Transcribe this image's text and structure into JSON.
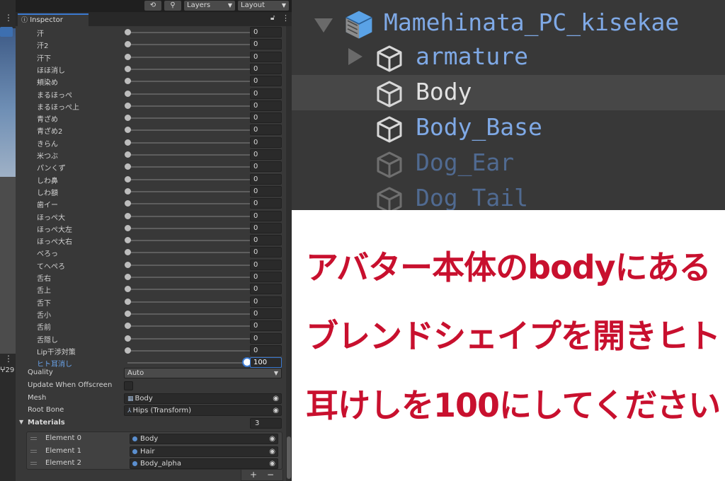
{
  "toolbar": {
    "history_icon": "history-icon",
    "search_icon": "search-icon",
    "layers_label": "Layers",
    "layout_label": "Layout"
  },
  "inspector": {
    "tab_label": "Inspector",
    "blendshapes": [
      {
        "name": "汗",
        "value": "0",
        "weight": 0
      },
      {
        "name": "汗2",
        "value": "0",
        "weight": 0
      },
      {
        "name": "汗下",
        "value": "0",
        "weight": 0
      },
      {
        "name": "ほほ消し",
        "value": "0",
        "weight": 0
      },
      {
        "name": "頬染め",
        "value": "0",
        "weight": 0
      },
      {
        "name": "まるほっぺ",
        "value": "0",
        "weight": 0
      },
      {
        "name": "まるほっぺ上",
        "value": "0",
        "weight": 0
      },
      {
        "name": "青ざめ",
        "value": "0",
        "weight": 0
      },
      {
        "name": "青ざめ2",
        "value": "0",
        "weight": 0
      },
      {
        "name": "きらん",
        "value": "0",
        "weight": 0
      },
      {
        "name": "米つぶ",
        "value": "0",
        "weight": 0
      },
      {
        "name": "パンくず",
        "value": "0",
        "weight": 0
      },
      {
        "name": "しわ鼻",
        "value": "0",
        "weight": 0
      },
      {
        "name": "しわ額",
        "value": "0",
        "weight": 0
      },
      {
        "name": "歯イー",
        "value": "0",
        "weight": 0
      },
      {
        "name": "ほっぺ大",
        "value": "0",
        "weight": 0
      },
      {
        "name": "ほっぺ大左",
        "value": "0",
        "weight": 0
      },
      {
        "name": "ほっぺ大右",
        "value": "0",
        "weight": 0
      },
      {
        "name": "べろっ",
        "value": "0",
        "weight": 0
      },
      {
        "name": "てへぺろ",
        "value": "0",
        "weight": 0
      },
      {
        "name": "舌右",
        "value": "0",
        "weight": 0
      },
      {
        "name": "舌上",
        "value": "0",
        "weight": 0
      },
      {
        "name": "舌下",
        "value": "0",
        "weight": 0
      },
      {
        "name": "舌小",
        "value": "0",
        "weight": 0
      },
      {
        "name": "舌前",
        "value": "0",
        "weight": 0
      },
      {
        "name": "舌隠し",
        "value": "0",
        "weight": 0
      },
      {
        "name": "Lip干渉対策",
        "value": "0",
        "weight": 0
      },
      {
        "name": "ヒト耳消し",
        "value": "100",
        "weight": 100,
        "active": true
      }
    ],
    "quality": {
      "label": "Quality",
      "value": "Auto"
    },
    "update_offscreen": {
      "label": "Update When Offscreen"
    },
    "mesh": {
      "label": "Mesh",
      "value": "Body"
    },
    "root_bone": {
      "label": "Root Bone",
      "value": "Hips (Transform)"
    },
    "materials": {
      "label": "Materials",
      "count": "3",
      "elements": [
        {
          "label": "Element 0",
          "value": "Body"
        },
        {
          "label": "Element 1",
          "value": "Hair"
        },
        {
          "label": "Element 2",
          "value": "Body_alpha"
        }
      ],
      "add": "+",
      "remove": "−"
    }
  },
  "scene": {
    "counter": "29"
  },
  "hierarchy": {
    "root": "Mamehinata_PC_kisekae",
    "children": [
      {
        "name": "armature",
        "expandable": true
      },
      {
        "name": "Body",
        "selected": true
      },
      {
        "name": "Body_Base"
      },
      {
        "name": "Dog_Ear",
        "inactive": true
      },
      {
        "name": "Dog_Tail",
        "inactive": true
      }
    ]
  },
  "instruction": {
    "lines": [
      "アバター本体のbodyにある",
      "ブレンドシェイプを開きヒト",
      "耳けしを100にしてください"
    ],
    "color": "#c8102e"
  }
}
